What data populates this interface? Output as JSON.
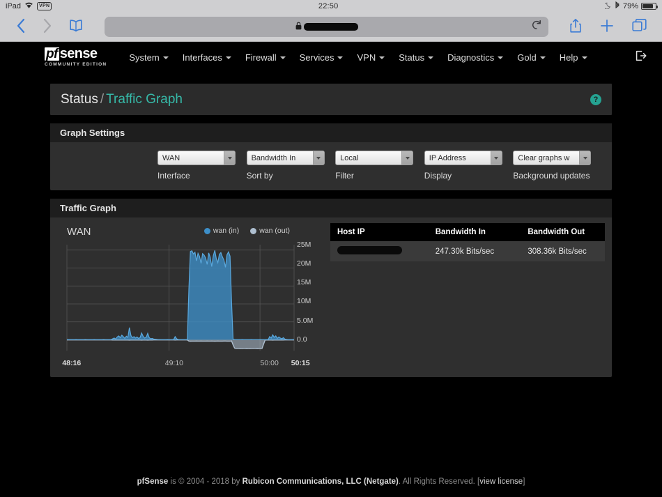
{
  "status_bar": {
    "device": "iPad",
    "wifi_icon": "wifi-icon",
    "vpn_label": "VPN",
    "time": "22:50",
    "moon_icon": "crescent-moon-icon",
    "bluetooth_icon": "bluetooth-icon",
    "battery_percent": "79%"
  },
  "browser": {
    "back_icon": "chevron-left-icon",
    "forward_icon": "chevron-right-icon",
    "bookmarks_icon": "book-icon",
    "lock_icon": "padlock-icon",
    "url_value": "",
    "reload_icon": "reload-icon",
    "share_icon": "share-icon",
    "new_tab_icon": "plus-icon",
    "tabs_icon": "tabs-icon"
  },
  "navbar": {
    "logo_prefix": "pf",
    "logo_main": "sense",
    "logo_sub": "COMMUNITY EDITION",
    "items": [
      {
        "label": "System"
      },
      {
        "label": "Interfaces"
      },
      {
        "label": "Firewall"
      },
      {
        "label": "Services"
      },
      {
        "label": "VPN"
      },
      {
        "label": "Status"
      },
      {
        "label": "Diagnostics"
      },
      {
        "label": "Gold"
      },
      {
        "label": "Help"
      }
    ],
    "logout_icon": "logout-icon"
  },
  "page_title": {
    "parent": "Status",
    "separator": "/",
    "current": "Traffic Graph",
    "help_icon": "question-mark-icon",
    "help_glyph": "?"
  },
  "graph_settings": {
    "panel_title": "Graph Settings",
    "controls": [
      {
        "value": "WAN",
        "label": "Interface"
      },
      {
        "value": "Bandwidth In",
        "label": "Sort by"
      },
      {
        "value": "Local",
        "label": "Filter"
      },
      {
        "value": "IP Address",
        "label": "Display"
      },
      {
        "value": "Clear graphs w",
        "label": "Background updates"
      }
    ]
  },
  "traffic_graph": {
    "panel_title": "Traffic Graph",
    "chart_title": "WAN"
  },
  "chart_data": {
    "type": "area",
    "title": "WAN",
    "xlabel": "",
    "ylabel": "",
    "ylim": [
      -3000000,
      26500000
    ],
    "yticks": [
      0,
      5000000,
      10000000,
      15000000,
      20000000,
      25000000
    ],
    "ytick_labels": [
      "0.0",
      "5.0M",
      "10M",
      "15M",
      "20M",
      "25M"
    ],
    "grid": true,
    "legend_position": "top-right",
    "xticks": [
      "48:16",
      "49:10",
      "50:00",
      "50:15"
    ],
    "xtick_positions_pct": [
      2,
      45,
      85,
      98
    ],
    "x_range_label": "48:16 - 50:15",
    "series": [
      {
        "name": "wan (in)",
        "color": "#3d8fc9",
        "values": [
          0.05,
          0.06,
          0.05,
          0.07,
          0.06,
          0.05,
          0.08,
          0.06,
          0.05,
          0.07,
          0.06,
          0.05,
          0.08,
          0.07,
          0.06,
          0.05,
          0.07,
          0.06,
          0.08,
          0.05,
          0.06,
          0.07,
          0.05,
          0.06,
          0.08,
          0.07,
          0.05,
          0.06,
          0.07,
          0.05,
          0.3,
          0.5,
          0.25,
          0.8,
          1.1,
          0.6,
          1.3,
          0.9,
          0.4,
          1.0,
          0.7,
          3.4,
          1.2,
          0.6,
          0.9,
          0.5,
          0.8,
          0.4,
          0.6,
          1.9,
          1.0,
          0.5,
          0.7,
          1.8,
          0.6,
          0.3,
          0.4,
          0.2,
          0.15,
          0.1,
          0.08,
          0.07,
          0.06,
          0.05,
          0.07,
          0.06,
          0.08,
          0.05,
          0.06,
          0.07,
          0.05,
          0.9,
          0.3,
          0.08,
          0.06,
          0.05,
          0.07,
          0.06,
          0.05,
          0.08,
          14.0,
          24.6,
          24.8,
          23.9,
          24.4,
          22.0,
          24.1,
          23.2,
          21.3,
          24.0,
          23.6,
          22.8,
          21.0,
          24.2,
          23.0,
          20.4,
          23.4,
          24.9,
          22.6,
          21.5,
          23.8,
          24.3,
          23.1,
          22.2,
          20.2,
          23.7,
          24.5,
          23.3,
          10.5,
          0.2,
          0.06,
          0.05,
          0.07,
          0.06,
          0.05,
          0.08,
          0.06,
          0.05,
          0.07,
          0.06,
          0.05,
          0.08,
          0.06,
          0.05,
          0.07,
          0.06,
          0.05,
          0.08,
          0.07,
          0.06,
          0.05,
          0.07,
          0.06,
          0.9,
          0.5,
          1.4,
          0.7,
          1.1,
          0.4,
          0.8,
          0.5,
          0.3,
          0.6,
          0.2,
          0.1,
          0.06,
          0.05,
          0.07,
          0.06,
          0.05
        ],
        "units": "Mbit/s"
      },
      {
        "name": "wan (out)",
        "color": "#aebfd0",
        "values": [
          0.02,
          0.02,
          0.02,
          0.02,
          0.02,
          0.02,
          0.02,
          0.02,
          0.02,
          0.02,
          0.02,
          0.02,
          0.02,
          0.02,
          0.02,
          0.02,
          0.02,
          0.02,
          0.02,
          0.02,
          0.02,
          0.02,
          0.02,
          0.02,
          0.02,
          0.02,
          0.02,
          0.02,
          0.02,
          0.02,
          0.05,
          0.05,
          0.05,
          0.06,
          0.06,
          0.05,
          0.06,
          0.06,
          0.05,
          0.06,
          0.05,
          0.08,
          0.06,
          0.05,
          0.06,
          0.05,
          0.06,
          0.05,
          0.05,
          0.07,
          0.06,
          0.05,
          0.05,
          0.07,
          0.05,
          0.04,
          0.04,
          0.03,
          0.03,
          0.02,
          0.02,
          0.02,
          0.02,
          0.02,
          0.02,
          0.02,
          0.02,
          0.02,
          0.02,
          0.02,
          0.02,
          0.05,
          0.03,
          0.02,
          0.02,
          0.02,
          0.02,
          0.02,
          0.02,
          0.02,
          0.35,
          0.38,
          0.36,
          0.37,
          0.36,
          0.35,
          0.36,
          0.37,
          0.35,
          0.36,
          0.37,
          0.36,
          0.35,
          0.37,
          0.36,
          0.35,
          0.36,
          0.38,
          0.36,
          0.35,
          0.37,
          0.36,
          0.36,
          0.35,
          0.34,
          0.36,
          0.37,
          0.36,
          0.3,
          1.4,
          2.3,
          2.4,
          2.35,
          2.4,
          2.38,
          2.42,
          2.36,
          2.4,
          2.37,
          2.41,
          2.39,
          2.4,
          2.36,
          2.38,
          2.4,
          2.37,
          2.41,
          2.35,
          2.4,
          1.2,
          0.06,
          0.05,
          0.04,
          0.06,
          0.05,
          0.07,
          0.05,
          0.06,
          0.04,
          0.05,
          0.04,
          0.03,
          0.04,
          0.02,
          0.02,
          0.02,
          0.02,
          0.02,
          0.02,
          0.02
        ],
        "units": "Mbit/s",
        "rendered_negative": true
      }
    ]
  },
  "host_table": {
    "columns": [
      "Host IP",
      "Bandwidth In",
      "Bandwidth Out"
    ],
    "rows": [
      {
        "host_ip": "",
        "host_ip_redacted": true,
        "bandwidth_in": "247.30k Bits/sec",
        "bandwidth_out": "308.36k Bits/sec"
      }
    ]
  },
  "footer": {
    "brand": "pfSense",
    "text1": " is © 2004 - 2018 by ",
    "company": "Rubicon Communications, LLC (Netgate)",
    "text2": ". All Rights Reserved. [",
    "link": "view license",
    "text3": "]"
  },
  "colors": {
    "accent_teal": "#36b9a8",
    "series_in": "#3d8fc9",
    "series_out": "#aebfd0",
    "panel_bg": "#2f2f2f",
    "panel_head_bg": "#1e1e1e",
    "page_bg": "#000000"
  }
}
